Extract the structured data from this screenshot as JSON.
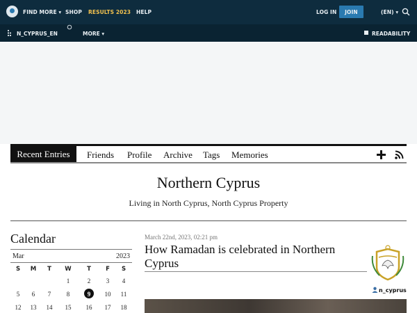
{
  "topbar": {
    "find_more": "FIND MORE ▾",
    "shop": "SHOP",
    "results": "RESULTS 2023",
    "help": "HELP",
    "login": "LOG IN",
    "join": "JOIN",
    "lang": "(EN) ▾",
    "results_color": "#f2c14e"
  },
  "journalbar": {
    "username": "N_CYPRUS_EN",
    "more": "MORE ▾",
    "readability": "READABILITY"
  },
  "nav": {
    "tabs": [
      "Recent Entries",
      "Friends",
      "Profile",
      "Archive",
      "Tags",
      "Memories"
    ],
    "active_index": 0
  },
  "header": {
    "title": "Northern Cyprus",
    "subtitle": "Living in North Cyprus, North Cyprus Property"
  },
  "calendar": {
    "title": "Calendar",
    "month": "Mar",
    "year": "2023",
    "days": [
      "S",
      "M",
      "T",
      "W",
      "T",
      "F",
      "S"
    ],
    "weeks": [
      [
        "",
        "",
        "",
        "1",
        "2",
        "3",
        "4"
      ],
      [
        "5",
        "6",
        "7",
        "8",
        "9",
        "10",
        "11"
      ],
      [
        "12",
        "13",
        "14",
        "15",
        "16",
        "17",
        "18"
      ]
    ],
    "today": "9"
  },
  "entry": {
    "date": "March 22nd, 2023, 02:21 pm",
    "title": "How Ramadan is celebrated in Northern Cyprus"
  },
  "user": {
    "name": "n_cyprus"
  }
}
